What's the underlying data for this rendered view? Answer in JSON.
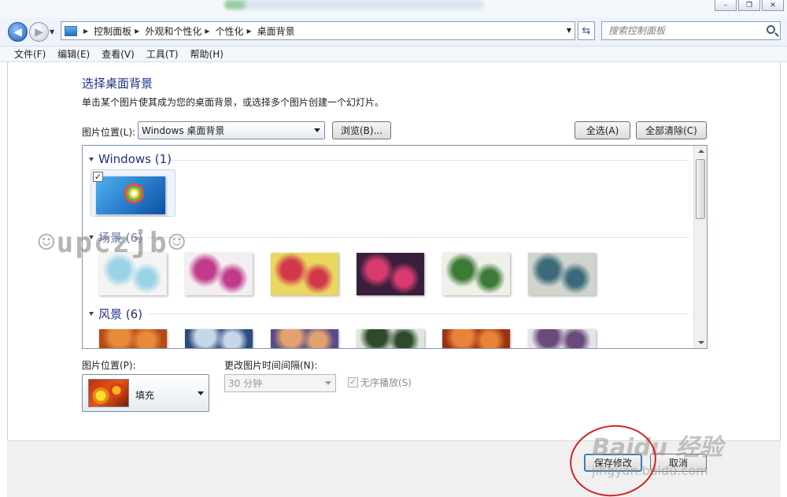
{
  "window": {
    "controls": [
      "minimize",
      "restore",
      "close"
    ]
  },
  "address_bar": {
    "breadcrumbs": [
      "控制面板",
      "外观和个性化",
      "个性化",
      "桌面背景"
    ],
    "search_placeholder": "搜索控制面板"
  },
  "menu": [
    "文件(F)",
    "编辑(E)",
    "查看(V)",
    "工具(T)",
    "帮助(H)"
  ],
  "page": {
    "title": "选择桌面背景",
    "description": "单击某个图片使其成为您的桌面背景，或选择多个图片创建一个幻灯片。",
    "location_label": "图片位置(L):",
    "location_value": "Windows 桌面背景",
    "browse_button": "浏览(B)...",
    "select_all_button": "全选(A)",
    "clear_all_button": "全部清除(C)"
  },
  "gallery": {
    "groups": [
      {
        "name": "Windows (1)",
        "thumbnails": [
          {
            "name": "windows-7-logo",
            "selected": true,
            "colors": [
              "#0b4fa8",
              "#4fb2ef"
            ]
          }
        ]
      },
      {
        "name": "场景 (6)",
        "thumbnails": [
          {
            "name": "scene-1",
            "colors": [
              "#f4f4f4",
              "#9bd3e6"
            ]
          },
          {
            "name": "scene-2",
            "colors": [
              "#f3eef2",
              "#c03b8a"
            ]
          },
          {
            "name": "scene-3",
            "colors": [
              "#e9d75f",
              "#d2384b"
            ]
          },
          {
            "name": "scene-4",
            "colors": [
              "#3a1f3c",
              "#d83b6f"
            ]
          },
          {
            "name": "scene-5",
            "colors": [
              "#eef0ea",
              "#3c7a35"
            ]
          },
          {
            "name": "scene-6",
            "colors": [
              "#cfd4cc",
              "#3d6a7a"
            ]
          }
        ]
      },
      {
        "name": "风景 (6)",
        "thumbnails": [
          {
            "name": "landscape-1",
            "colors": [
              "#b64a18",
              "#e78a3a"
            ]
          },
          {
            "name": "landscape-2",
            "colors": [
              "#2c4d7c",
              "#c7d6e8"
            ]
          },
          {
            "name": "landscape-3",
            "colors": [
              "#5a4b8a",
              "#e0a36f"
            ]
          },
          {
            "name": "landscape-4",
            "colors": [
              "#dfe6de",
              "#2e4a2a"
            ]
          },
          {
            "name": "landscape-5",
            "colors": [
              "#9c3214",
              "#e7843a"
            ]
          },
          {
            "name": "landscape-6",
            "colors": [
              "#e6e3ea",
              "#6a4a7a"
            ]
          }
        ]
      }
    ]
  },
  "options": {
    "position_label": "图片位置(P):",
    "position_value": "填充",
    "interval_label": "更改图片时间间隔(N):",
    "interval_value": "30 分钟",
    "shuffle_label": "无序播放(S)",
    "shuffle_checked": true
  },
  "footer": {
    "save_button": "保存修改",
    "cancel_button": "取消"
  },
  "watermarks": {
    "left": "☺upczjb☺",
    "baidu": "Baidu 经验",
    "url": "jingyan.baidu.com"
  },
  "colors": {
    "title_blue": "#1e3287",
    "annotation_red": "#d42222"
  }
}
